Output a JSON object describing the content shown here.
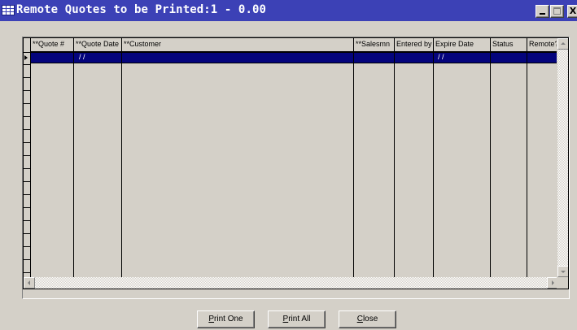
{
  "window": {
    "title": "Remote Quotes to be Printed:1 - 0.00",
    "caption_buttons": [
      "_",
      "□",
      "X"
    ]
  },
  "grid": {
    "columns": [
      {
        "key": "quote_no",
        "label": "**Quote #"
      },
      {
        "key": "quote_date",
        "label": "**Quote Date"
      },
      {
        "key": "customer",
        "label": "**Customer"
      },
      {
        "key": "salesmn",
        "label": "**Salesmn"
      },
      {
        "key": "entered_by",
        "label": "Entered by"
      },
      {
        "key": "expire_date",
        "label": "Expire Date"
      },
      {
        "key": "status",
        "label": "Status"
      },
      {
        "key": "remote",
        "label": "Remote?"
      }
    ],
    "selected_row": {
      "quote_no": "",
      "quote_date": "/ /",
      "customer": "",
      "salesmn": "",
      "entered_by": "",
      "expire_date": "/ /",
      "status": "",
      "remote": ""
    }
  },
  "buttons": {
    "print_one": {
      "accel": "P",
      "rest": "rint One"
    },
    "print_all": {
      "accel": "P",
      "rest": "rint All"
    },
    "close": {
      "accel": "C",
      "rest": "lose"
    }
  },
  "colors": {
    "title_bar": "#3c41b6",
    "selected_row": "#04047c",
    "face": "#d4d0c8"
  }
}
